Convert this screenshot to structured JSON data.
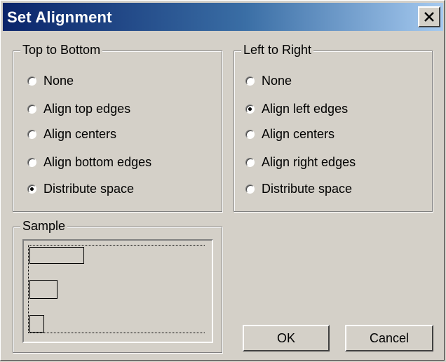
{
  "window": {
    "title": "Set Alignment",
    "close_icon": "close-icon"
  },
  "top_to_bottom": {
    "legend": "Top to Bottom",
    "options": [
      "None",
      "Align top edges",
      "Align centers",
      "Align bottom edges",
      "Distribute space"
    ],
    "selected": "Distribute space"
  },
  "left_to_right": {
    "legend": "Left to Right",
    "options": [
      "None",
      "Align left edges",
      "Align centers",
      "Align right edges",
      "Distribute space"
    ],
    "selected": "Align left edges"
  },
  "sample": {
    "legend": "Sample"
  },
  "buttons": {
    "ok": "OK",
    "cancel": "Cancel"
  }
}
